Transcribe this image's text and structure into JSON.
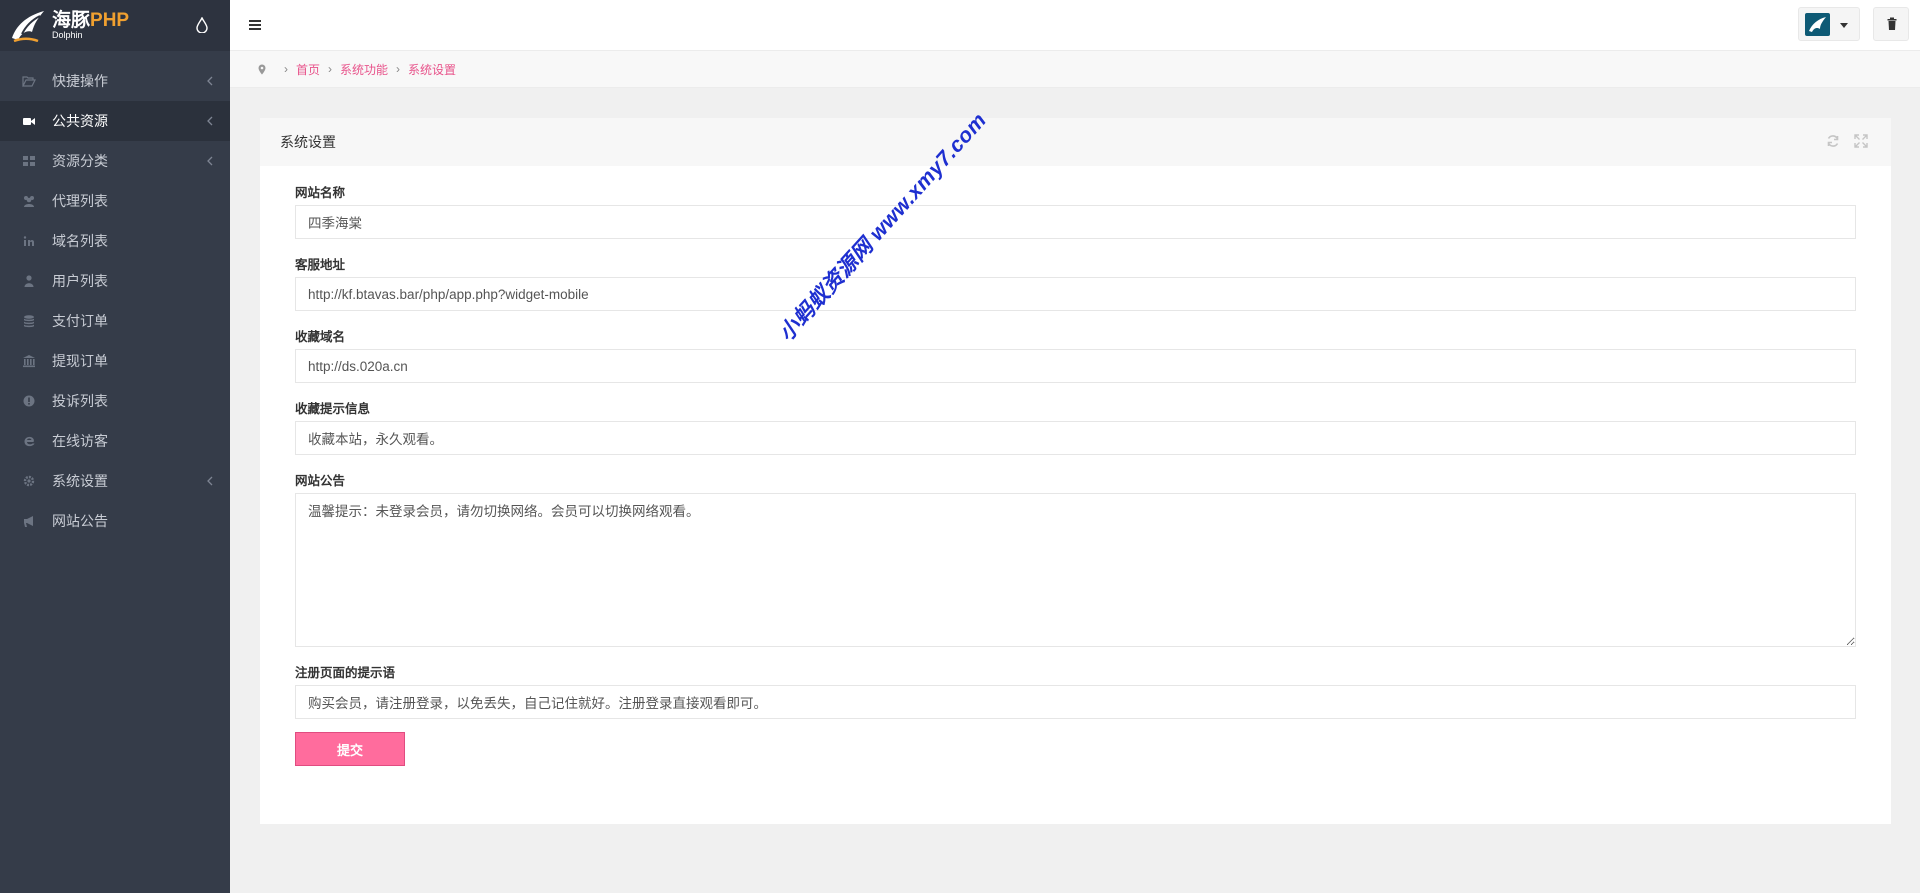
{
  "brand": {
    "name_part1": "海豚",
    "name_part2": "PHP",
    "sub": "Dolphin"
  },
  "sidebar": {
    "items": [
      {
        "label": "快捷操作",
        "icon": "folder-open-icon",
        "has_children": true,
        "active": false
      },
      {
        "label": "公共资源",
        "icon": "video-camera-icon",
        "has_children": true,
        "active": true
      },
      {
        "label": "资源分类",
        "icon": "grid-icon",
        "has_children": true,
        "active": false
      },
      {
        "label": "代理列表",
        "icon": "users-icon",
        "has_children": false,
        "active": false
      },
      {
        "label": "域名列表",
        "icon": "linkedin-icon",
        "has_children": false,
        "active": false
      },
      {
        "label": "用户列表",
        "icon": "user-icon",
        "has_children": false,
        "active": false
      },
      {
        "label": "支付订单",
        "icon": "database-icon",
        "has_children": false,
        "active": false
      },
      {
        "label": "提现订单",
        "icon": "bank-icon",
        "has_children": false,
        "active": false
      },
      {
        "label": "投诉列表",
        "icon": "exclamation-circle-icon",
        "has_children": false,
        "active": false
      },
      {
        "label": "在线访客",
        "icon": "ie-icon",
        "has_children": false,
        "active": false
      },
      {
        "label": "系统设置",
        "icon": "gear-icon",
        "has_children": true,
        "active": false
      },
      {
        "label": "网站公告",
        "icon": "bullhorn-icon",
        "has_children": false,
        "active": false
      }
    ]
  },
  "breadcrumb": {
    "items": [
      "首页",
      "系统功能",
      "系统设置"
    ]
  },
  "panel": {
    "title": "系统设置"
  },
  "form": {
    "site_name": {
      "label": "网站名称",
      "value": "四季海棠"
    },
    "service_url": {
      "label": "客服地址",
      "value": "http://kf.btavas.bar/php/app.php?widget-mobile"
    },
    "favorite_domain": {
      "label": "收藏域名",
      "value": "http://ds.020a.cn"
    },
    "favorite_tip": {
      "label": "收藏提示信息",
      "value": "收藏本站，永久观看。"
    },
    "notice": {
      "label": "网站公告",
      "value": "温馨提示：未登录会员，请勿切换网络。会员可以切换网络观看。"
    },
    "register_tip": {
      "label": "注册页面的提示语",
      "value": "购买会员，请注册登录，以免丢失，自己记住就好。注册登录直接观看即可。"
    },
    "submit_label": "提交"
  },
  "watermark": {
    "text": "小蚂蚁资源网 www.xmy7.com"
  },
  "colors": {
    "sidebar_bg": "#353c49",
    "accent_pink": "#ff6c9d",
    "link_pink": "#e8538b"
  }
}
